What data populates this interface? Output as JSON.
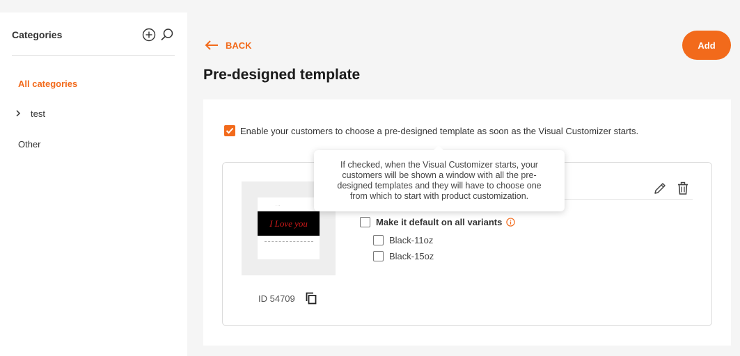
{
  "sidebar": {
    "title": "Categories",
    "items": [
      {
        "label": "All categories",
        "active": true
      },
      {
        "label": "test",
        "expandable": true
      },
      {
        "label": "Other"
      }
    ]
  },
  "header": {
    "back_label": "BACK",
    "title": "Pre-designed template",
    "add_label": "Add"
  },
  "settings": {
    "enable_label": "Enable your customers to choose a pre-designed template as soon as the Visual Customizer starts.",
    "enable_checked": true,
    "tooltip": "If checked, when the Visual Customizer starts, your customers will be shown a window with all the pre-designed templates and they will have to choose one from which to start with product customization."
  },
  "template": {
    "id_label": "ID 54709",
    "thumb_text": "I Love you",
    "default_label": "Make it default on all variants",
    "variants": [
      {
        "label": "Black-11oz",
        "checked": false
      },
      {
        "label": "Black-15oz",
        "checked": false
      }
    ]
  },
  "colors": {
    "accent": "#f26a1b"
  }
}
